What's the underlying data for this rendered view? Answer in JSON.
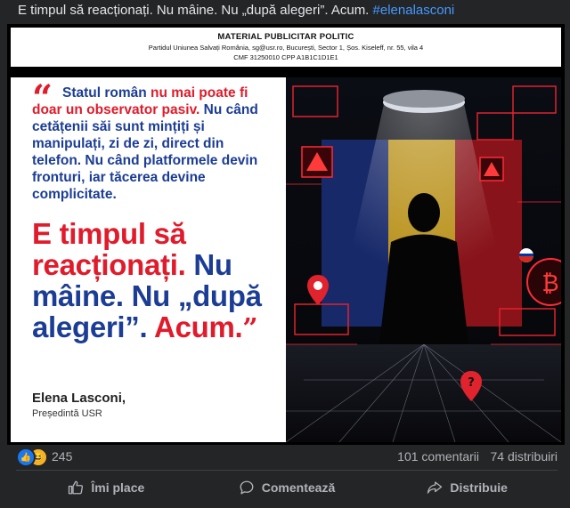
{
  "post": {
    "text": "E timpul să reacționați. Nu mâine. Nu „după alegeri”. Acum.",
    "hashtag": "#elenalasconi"
  },
  "image": {
    "disclaimer": {
      "title": "MATERIAL PUBLICITAR POLITIC",
      "line1": "Partidul Uniunea Salvați România, sg@usr.ro, București, Sector 1, Șos. Kiseleff, nr. 55, vila 4",
      "line2": "CMF 31250010    CPP A1B1C1D1E1"
    },
    "quote": {
      "open_mark": "“",
      "body_red": "Statul român nu mai poate",
      "body_lead": "Statul român",
      "body_red_part": "nu mai poate",
      "body_rest_red": "fi doar un observator pasiv.",
      "body_blue": "Nu când cetățenii săi sunt mințiți și manipulați, zi de zi, direct din telefon. Nu când platformele devin fronturi, iar tăcerea devine complicitate.",
      "big_red": "E timpul să reacționați.",
      "big_blue": "Nu mâine. Nu „după alegeri”.",
      "big_red_end": "Acum.",
      "close_mark": "”",
      "author": "Elena Lasconi,",
      "role": "Președintă USR"
    },
    "art": {
      "description_icons": [
        "warning-icon",
        "location-pin-icon",
        "bitcoin-icon",
        "flag-icon"
      ]
    }
  },
  "stats": {
    "reaction_count": "245",
    "comments": "101 comentarii",
    "shares": "74 distribuiri"
  },
  "actions": {
    "like": "Îmi place",
    "comment": "Comentează",
    "share": "Distribuie"
  },
  "colors": {
    "accent_red": "#e01b2b",
    "accent_blue": "#1c3d95",
    "link": "#4599ff",
    "bg": "#242526"
  }
}
